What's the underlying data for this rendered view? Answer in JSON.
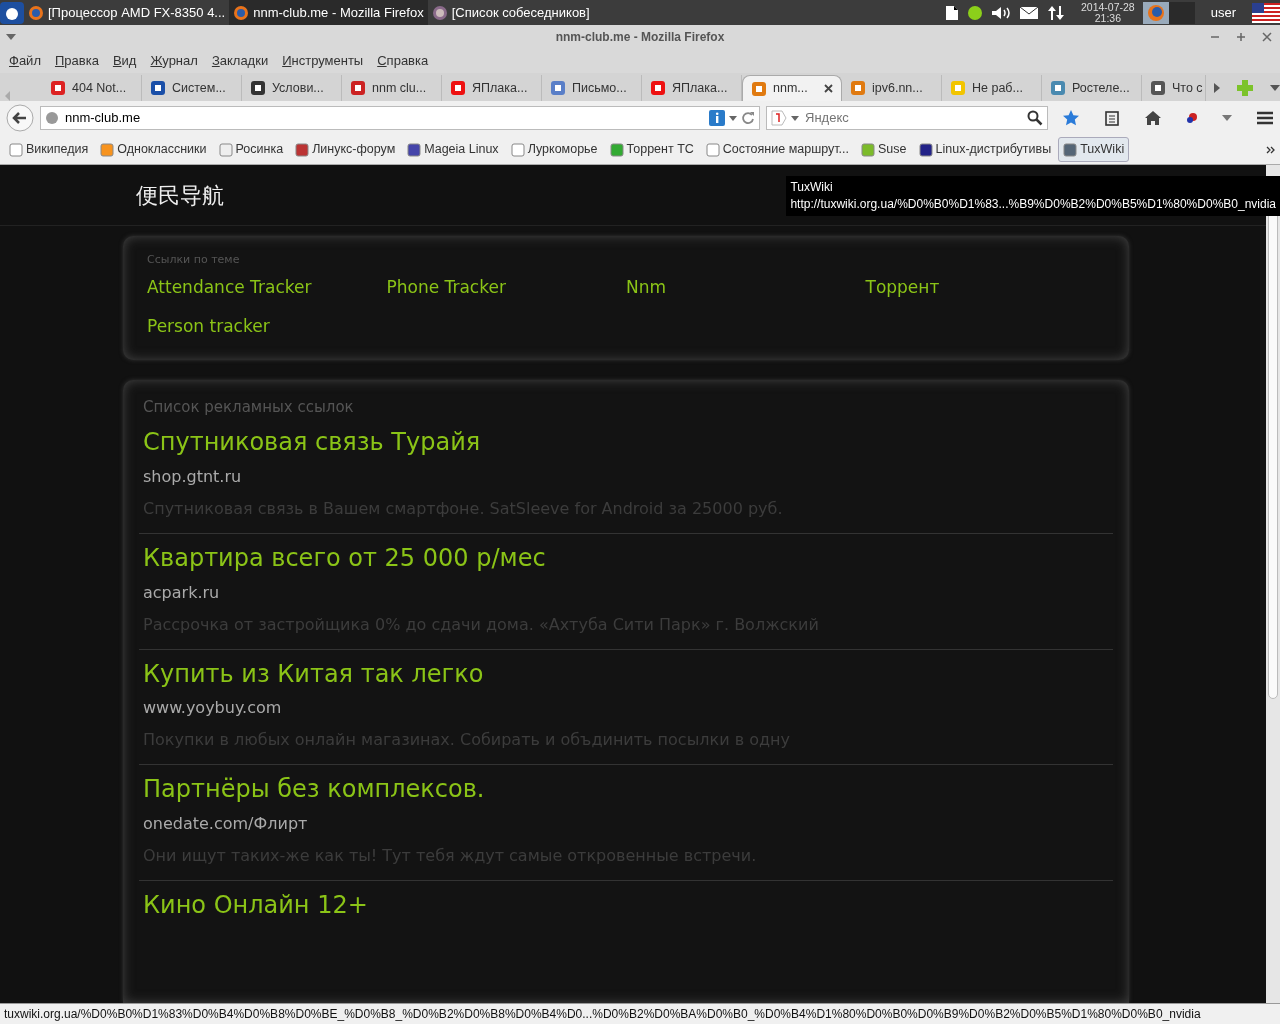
{
  "taskbar": {
    "tasks": [
      {
        "label": "[Процессор AMD FX-8350 4...",
        "selected": false
      },
      {
        "label": "nnm-club.me - Mozilla Firefox",
        "selected": true
      },
      {
        "label": "[Список собеседников]",
        "selected": false
      }
    ],
    "date": "2014-07-28",
    "time": "21:36",
    "user": "user"
  },
  "window": {
    "title": "nnm-club.me - Mozilla Firefox"
  },
  "menu": [
    "Файл",
    "Правка",
    "Вид",
    "Журнал",
    "Закладки",
    "Инструменты",
    "Справка"
  ],
  "tabs": [
    {
      "label": "404 Not...",
      "selected": false
    },
    {
      "label": "Систем...",
      "selected": false
    },
    {
      "label": "Услови...",
      "selected": false
    },
    {
      "label": "nnm clu...",
      "selected": false
    },
    {
      "label": "ЯПлака...",
      "selected": false
    },
    {
      "label": "Письмо...",
      "selected": false
    },
    {
      "label": "ЯПлака...",
      "selected": false
    },
    {
      "label": "nnm...",
      "selected": true
    },
    {
      "label": "ipv6.nn...",
      "selected": false
    },
    {
      "label": "Не раб...",
      "selected": false
    },
    {
      "label": "Ростеле...",
      "selected": false
    },
    {
      "label": "Что с",
      "selected": false
    }
  ],
  "address": {
    "value": "nnm-club.me"
  },
  "search": {
    "placeholder": "Яндекс"
  },
  "bookmarks": [
    {
      "label": "Википедия",
      "selected": false
    },
    {
      "label": "Одноклассники",
      "selected": false
    },
    {
      "label": "Росинка",
      "selected": false
    },
    {
      "label": "Линукс-форум",
      "selected": false
    },
    {
      "label": "Mageia Linux",
      "selected": false
    },
    {
      "label": "Луркоморье",
      "selected": false
    },
    {
      "label": "Торрент ТС",
      "selected": false
    },
    {
      "label": "Состояние маршрут...",
      "selected": false
    },
    {
      "label": "Suse",
      "selected": false
    },
    {
      "label": "Linux-дистрибутивы",
      "selected": false
    },
    {
      "label": "TuxWiki",
      "selected": true
    }
  ],
  "page": {
    "logo": "便民导航",
    "tooltip": {
      "title": "TuxWiki",
      "url": "http://tuxwiki.org.ua/%D0%B0%D1%83...%B9%D0%B2%D0%B5%D1%80%D0%B0_nvidia"
    },
    "related": {
      "heading": "Ссылки по теме",
      "links": [
        "Attendance Tracker",
        "Phone Tracker",
        "Nnm",
        "Торрент",
        "Person tracker"
      ]
    },
    "ads": {
      "heading": "Список рекламных ссылок",
      "items": [
        {
          "title": "Спутниковая связь Турайя",
          "domain": "shop.gtnt.ru",
          "text": "Спутниковая связь в Вашем смартфоне. SatSleeve for Android за 25000 руб."
        },
        {
          "title": "Квартира всего от 25 000 р/мес",
          "domain": "acpark.ru",
          "text": "Рассрочка от застройщика 0% до сдачи дома. «Ахтуба Сити Парк» г. Волжский"
        },
        {
          "title": "Купить из Китая так легко",
          "domain": "www.yoybuy.com",
          "text": "Покупки в любых онлайн магазинах. Собирать и объдинить посылки в одну"
        },
        {
          "title": "Партнёры без комплексов.",
          "domain": "onedate.com/Флирт",
          "text": "Они ищут таких-же как ты! Тут тебя ждут самые откровенные встречи."
        },
        {
          "title": "Кино Онлайн 12+"
        }
      ]
    }
  },
  "status_bar": "tuxwiki.org.ua/%D0%B0%D1%83%D0%B4%D0%B8%D0%BE_%D0%B8_%D0%B2%D0%B8%D0%B4%D0...%D0%B2%D0%BA%D0%B0_%D0%B4%D1%80%D0%B0%D0%B9%D0%B2%D0%B5%D1%80%D0%B0_nvidia"
}
